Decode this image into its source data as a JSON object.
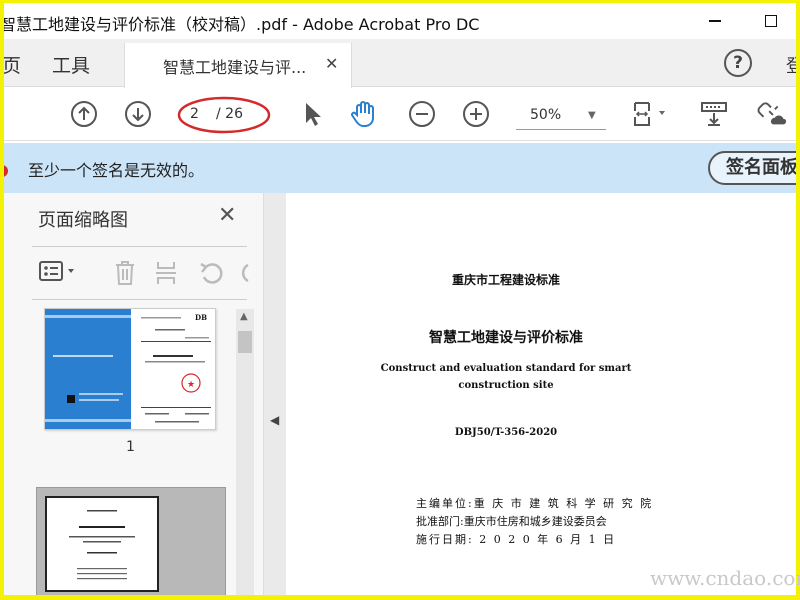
{
  "window": {
    "title": "智慧工地建设与评价标准（校对稿）.pdf - Adobe Acrobat Pro DC"
  },
  "tabs": {
    "home": "页",
    "tools": "工具",
    "document": "智慧工地建设与评...",
    "help": "?",
    "login": "登"
  },
  "toolbar": {
    "page_current": "2",
    "page_total": "/ 26",
    "zoom": "50%"
  },
  "notification": {
    "text": "至少一个签名是无效的。",
    "button": "签名面板"
  },
  "panel": {
    "title": "页面缩略图",
    "thumb1_label": "1"
  },
  "document": {
    "org": "重庆市工程建设标准",
    "title_cn": "智慧工地建设与评价标准",
    "title_en_1": "Construct and evaluation standard for smart",
    "title_en_2": "construction site",
    "code": "DBJ50/T-356-2020",
    "editor": "主编单位:重 庆 市 建 筑 科 学 研 究 院",
    "approver": "批准部门:重庆市住房和城乡建设委员会",
    "date": "施行日期: 2 0 2 0 年 6 月 1 日"
  },
  "watermark": "www.cndao.com",
  "colors": {
    "frame_border": "#f3f205",
    "notification_bg": "#cbe4f7",
    "annotation_red": "#d32b2b",
    "hand_tool_blue": "#2a7fd0"
  }
}
